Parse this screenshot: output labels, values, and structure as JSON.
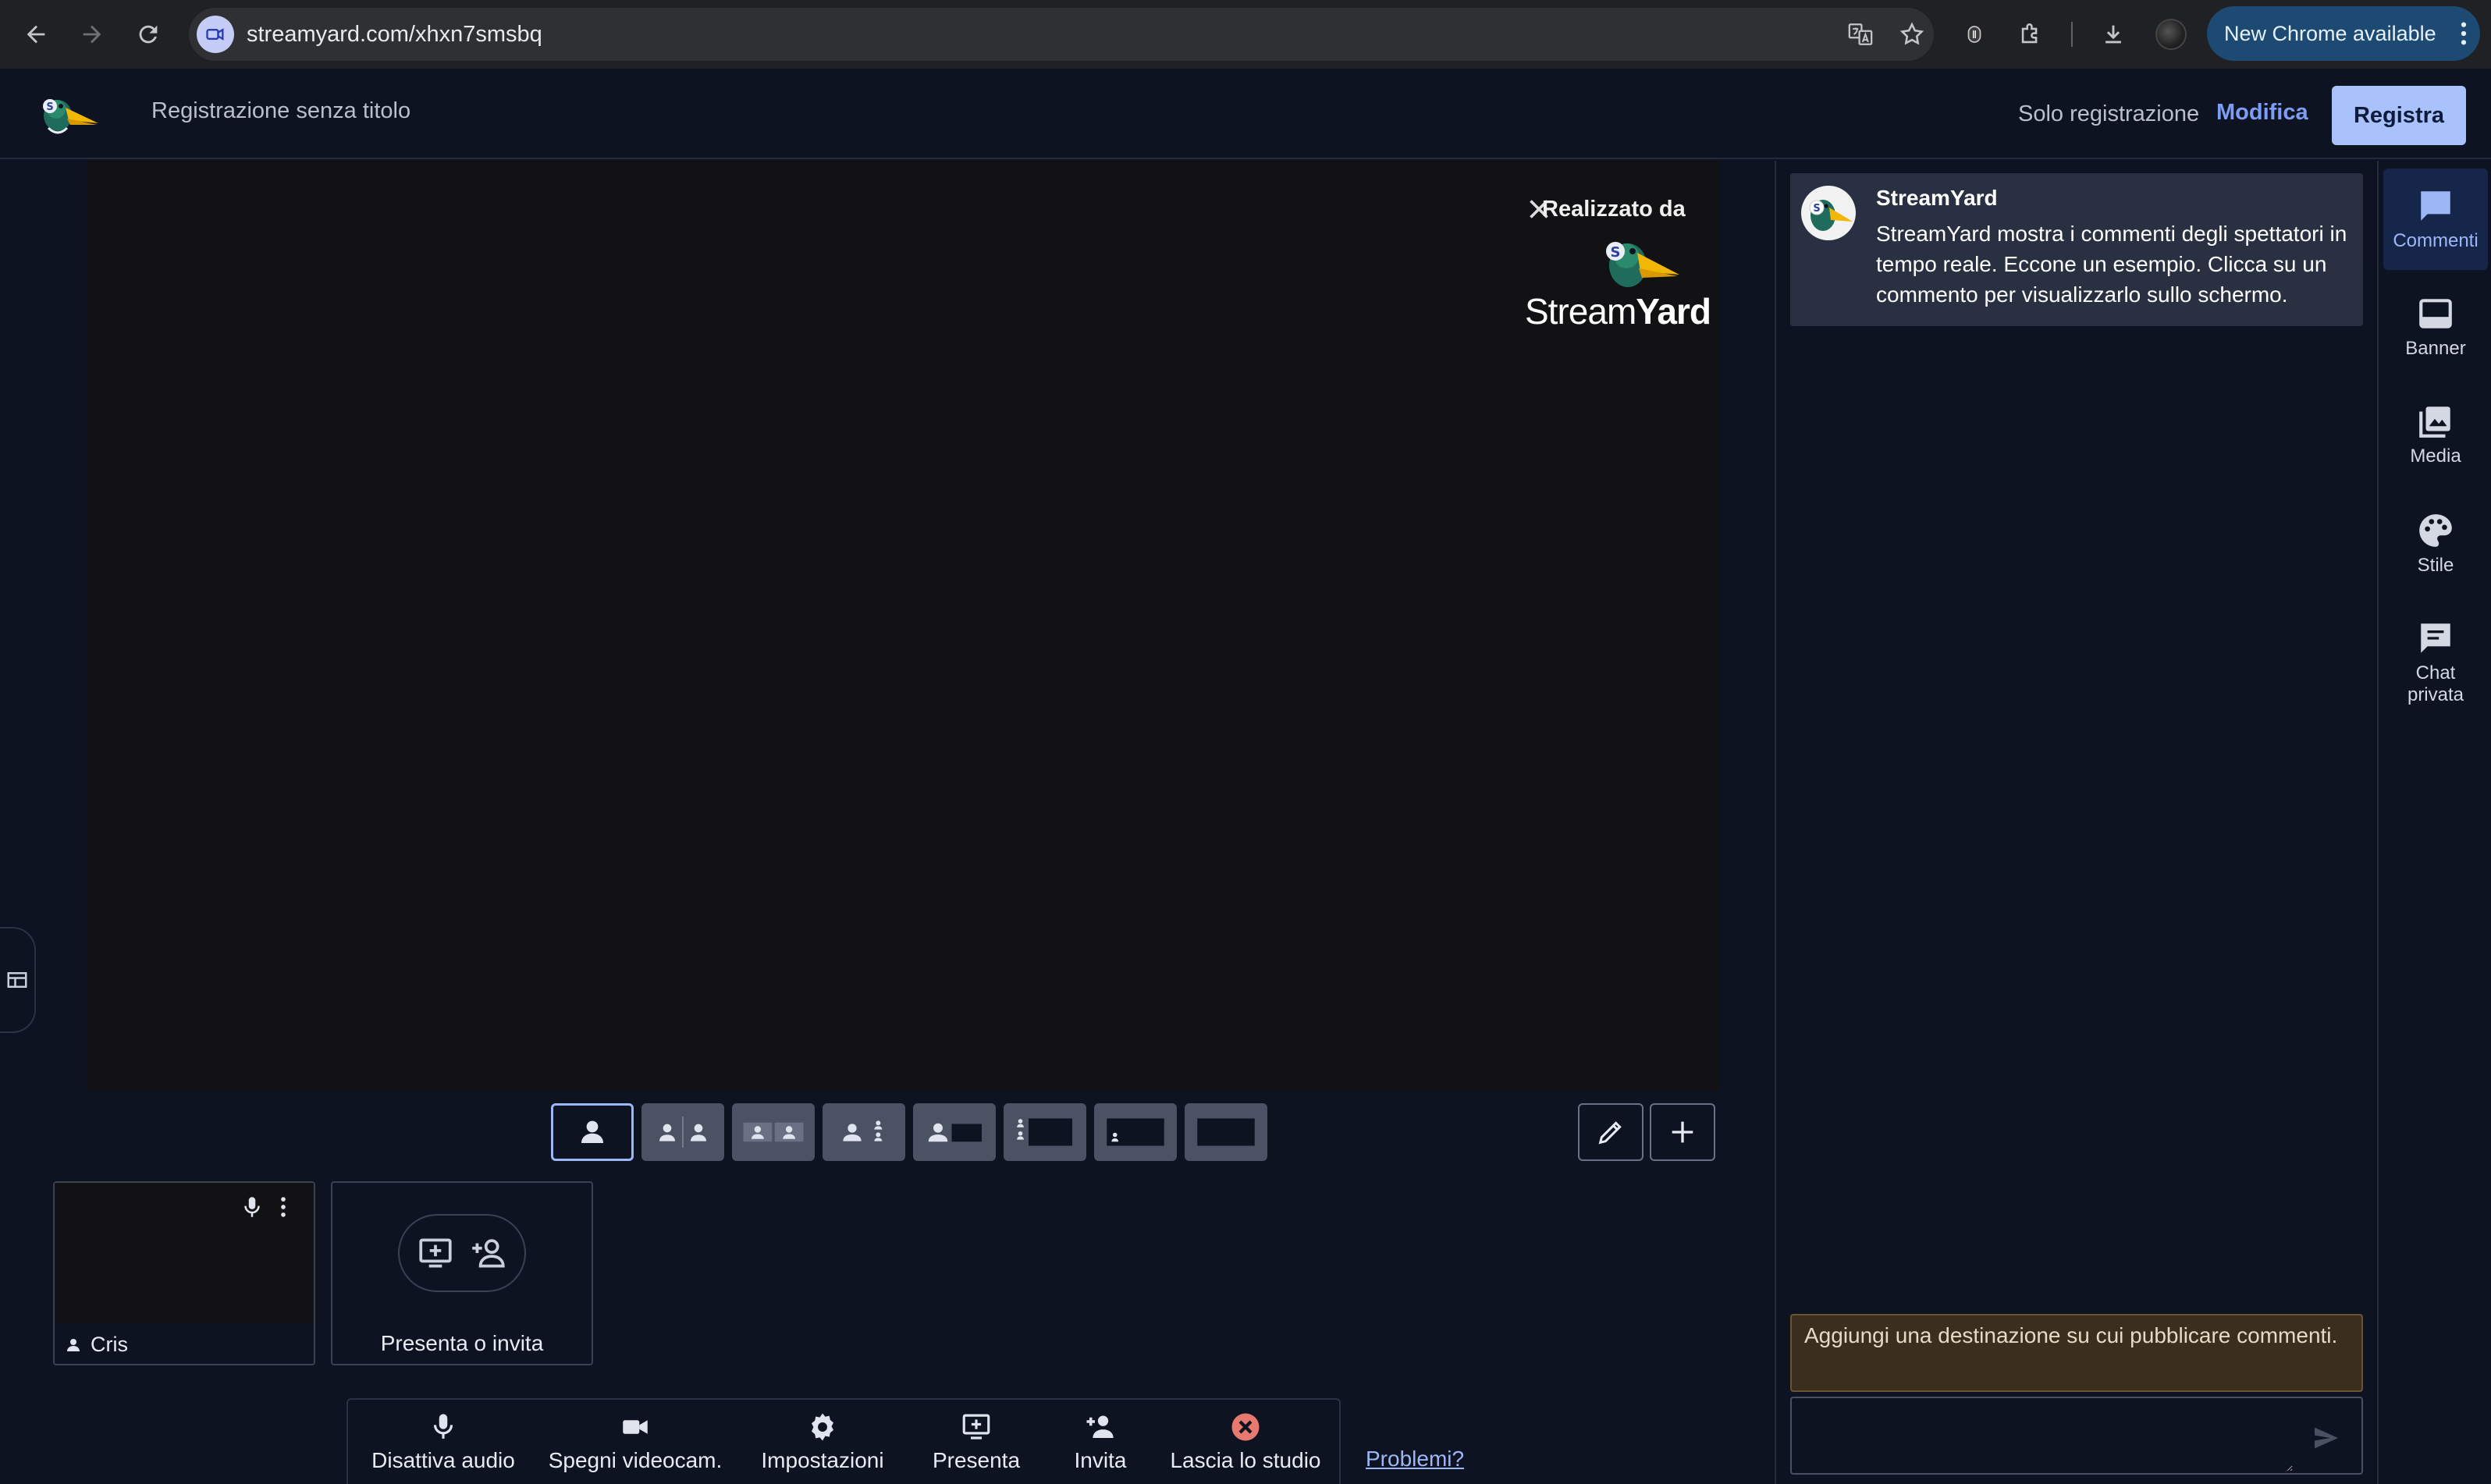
{
  "browser": {
    "url": "streamyard.com/xhxn7smsbq",
    "update_label": "New Chrome available"
  },
  "header": {
    "recording_title": "Registrazione senza titolo",
    "mode_label": "Solo registrazione",
    "edit_label": "Modifica",
    "record_label": "Registra"
  },
  "stage": {
    "credit_text": "Realizzato da",
    "brand_light": "Stream",
    "brand_bold": "Yard"
  },
  "participants": [
    {
      "name": "Cris"
    }
  ],
  "present_tile": {
    "label": "Presenta o invita"
  },
  "toolbar": {
    "mute": "Disattiva audio",
    "camera": "Spegni videocam.",
    "settings": "Impostazioni",
    "present": "Presenta",
    "invite": "Invita",
    "leave": "Lascia lo studio",
    "problems": "Problemi?"
  },
  "comments": {
    "items": [
      {
        "author": "StreamYard",
        "text": "StreamYard mostra i commenti degli spettatori in tempo reale. Eccone un esempio. Clicca su un commento per visualizzarlo sullo schermo."
      }
    ],
    "destination_warning": "Aggiungi una destinazione su cui pubblicare commenti.",
    "input_value": "",
    "input_placeholder": ""
  },
  "rail": {
    "items": [
      {
        "label": "Commenti",
        "icon": "comment-icon"
      },
      {
        "label": "Banner",
        "icon": "banner-icon"
      },
      {
        "label": "Media",
        "icon": "media-icon"
      },
      {
        "label": "Stile",
        "icon": "palette-icon"
      },
      {
        "label": "Chat privata",
        "icon": "chat-icon"
      }
    ]
  },
  "colors": {
    "background": "#0d1321",
    "accent": "#a9c2fb",
    "link": "#7e9ef5",
    "leave": "#e8796e"
  }
}
